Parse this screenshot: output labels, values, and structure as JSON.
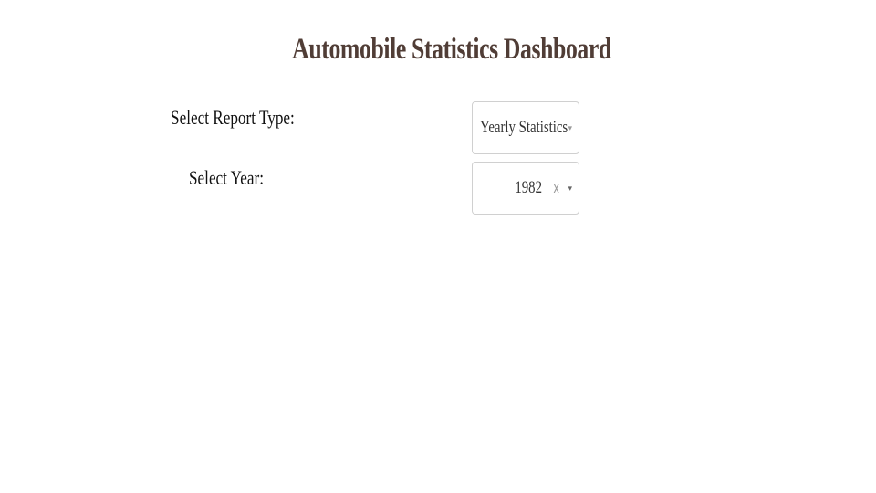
{
  "page": {
    "title": "Automobile Statistics Dashboard",
    "title_color": "#503d36"
  },
  "report_type": {
    "label": "Select Report Type:",
    "selected": "Yearly Statistics",
    "arrow_icon": "▾"
  },
  "year": {
    "label": "Select Year:",
    "selected": "1982",
    "clear_icon": "x",
    "arrow_icon": "▾"
  }
}
